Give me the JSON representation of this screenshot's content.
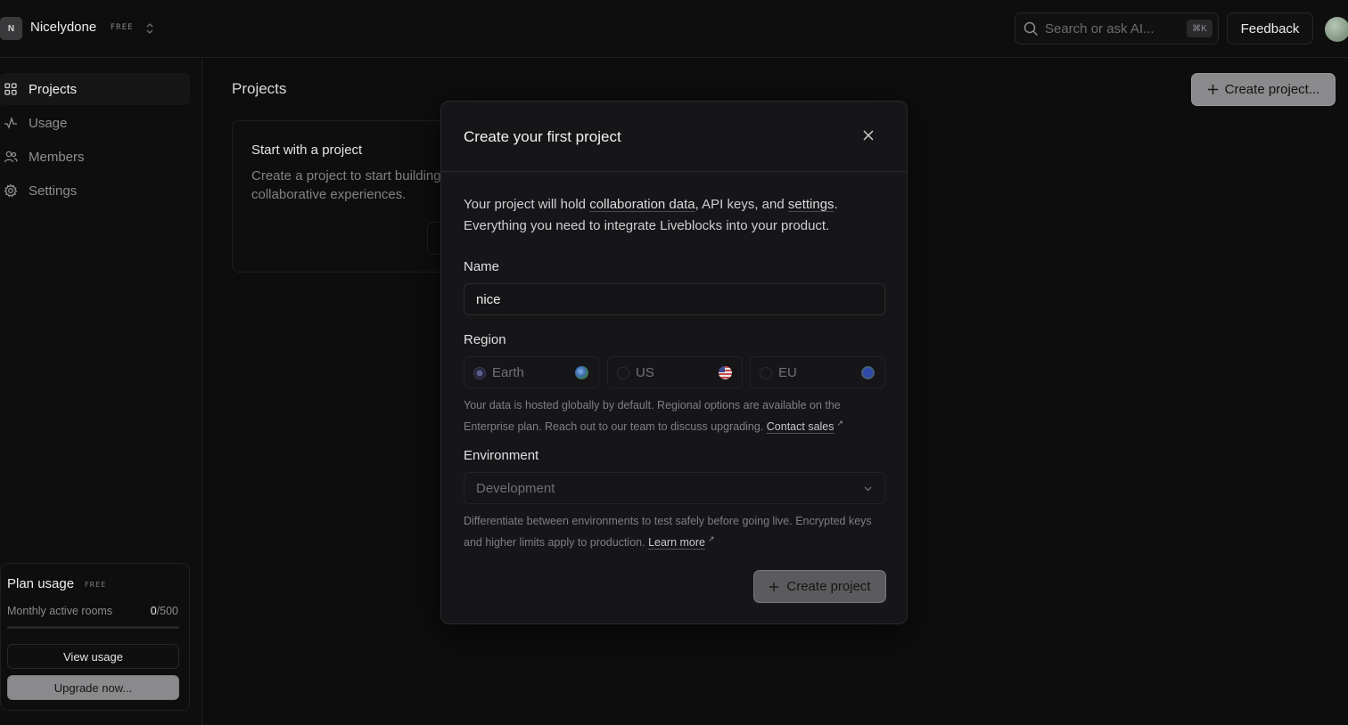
{
  "org": {
    "initial": "N",
    "name": "Nicelydone",
    "plan_badge": "FREE"
  },
  "search": {
    "placeholder": "Search or ask AI...",
    "shortcut": "⌘K"
  },
  "header": {
    "feedback_label": "Feedback"
  },
  "sidebar": {
    "items": [
      {
        "label": "Projects",
        "icon": "grid-icon",
        "active": true
      },
      {
        "label": "Usage",
        "icon": "activity-icon",
        "active": false
      },
      {
        "label": "Members",
        "icon": "users-icon",
        "active": false
      },
      {
        "label": "Settings",
        "icon": "gear-icon",
        "active": false
      }
    ],
    "plan": {
      "title": "Plan usage",
      "badge": "FREE",
      "metric_label": "Monthly active rooms",
      "metric_value": "0",
      "metric_limit": "/500",
      "progress": 0,
      "view_usage_label": "View usage",
      "upgrade_label": "Upgrade now..."
    }
  },
  "main": {
    "title": "Projects",
    "create_label": "Create project...",
    "empty": {
      "title": "Start with a project",
      "description": "Create a project to start building collaborative experiences."
    }
  },
  "modal": {
    "title": "Create your first project",
    "intro_1": "Your project will hold ",
    "intro_link_1": "collaboration data",
    "intro_2": ", API keys, and ",
    "intro_link_2": "settings",
    "intro_3": ". Everything you need to integrate Liveblocks into your product.",
    "name_label": "Name",
    "name_value": "nice",
    "region_label": "Region",
    "regions": [
      {
        "label": "Earth",
        "selected": true,
        "icon": "globe-icon"
      },
      {
        "label": "US",
        "selected": false,
        "icon": "us-flag-icon"
      },
      {
        "label": "EU",
        "selected": false,
        "icon": "eu-flag-icon"
      }
    ],
    "region_hint": "Your data is hosted globally by default. Regional options are available on the Enterprise plan. Reach out to our team to discuss upgrading. ",
    "region_hint_link": "Contact sales",
    "environment_label": "Environment",
    "environment_value": "Development",
    "environment_hint": "Differentiate between environments to test safely before going live. Encrypted keys and higher limits apply to production. ",
    "environment_hint_link": "Learn more",
    "submit_label": "Create project"
  },
  "colors": {
    "accent_button": "#8a8a8d",
    "background": "#0d0d0e",
    "modal": "#161618"
  }
}
